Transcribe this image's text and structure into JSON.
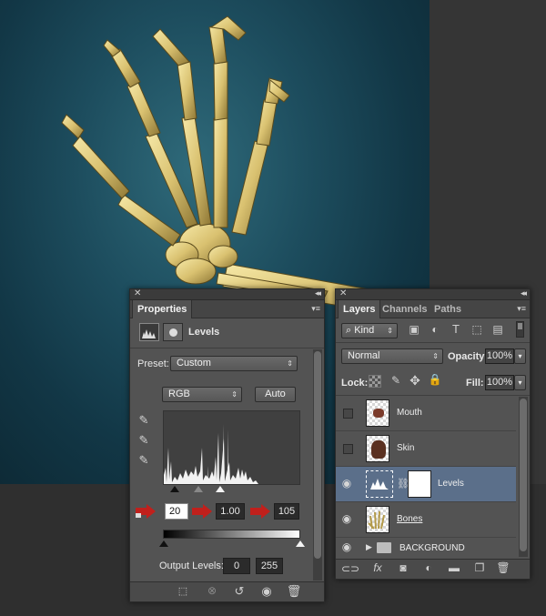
{
  "canvas": {
    "background": "#1d4d5e"
  },
  "properties": {
    "tab": "Properties",
    "adjustment_name": "Levels",
    "preset_label": "Preset:",
    "preset_value": "Custom",
    "channel_value": "RGB",
    "auto_label": "Auto",
    "input_black": "20",
    "input_gamma": "1.00",
    "input_white": "105",
    "output_label": "Output Levels:",
    "output_black": "0",
    "output_white": "255",
    "icons": {
      "clip": "clip-to-layer-icon",
      "view_previous": "view-previous-icon",
      "reset": "reset-icon",
      "visibility": "eye-icon",
      "delete": "trash-icon"
    }
  },
  "layers": {
    "tabs": [
      "Layers",
      "Channels",
      "Paths"
    ],
    "filter_kind": "Kind",
    "blend_mode": "Normal",
    "opacity_label": "Opacity:",
    "opacity_value": "100%",
    "lock_label": "Lock:",
    "fill_label": "Fill:",
    "fill_value": "100%",
    "items": [
      {
        "name": "Mouth",
        "visible": false,
        "type": "pixel"
      },
      {
        "name": "Skin",
        "visible": false,
        "type": "pixel"
      },
      {
        "name": "Levels",
        "visible": true,
        "type": "adjustment",
        "selected": true
      },
      {
        "name": "Bones",
        "visible": true,
        "type": "pixel"
      },
      {
        "name": "BACKGROUND",
        "visible": true,
        "type": "group"
      }
    ],
    "bottom_icons": [
      "link-icon",
      "fx-icon",
      "mask-icon",
      "adjustment-icon",
      "folder-icon",
      "new-layer-icon",
      "trash-icon"
    ]
  },
  "colors": {
    "panel_bg": "#535353",
    "selected_row": "#5b6f8a",
    "arrow_red": "#c0201c"
  }
}
